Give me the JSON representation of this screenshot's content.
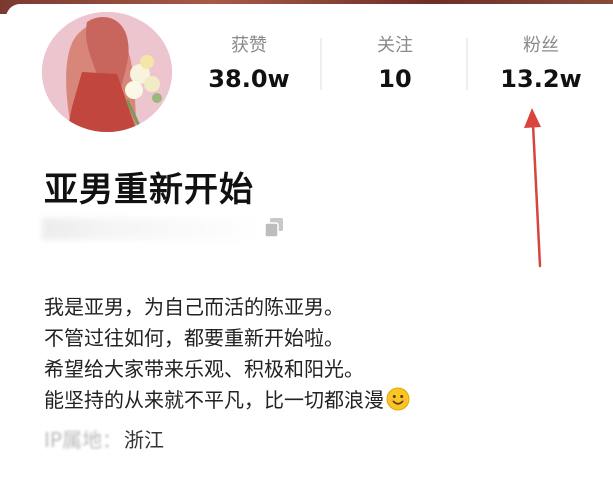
{
  "profile": {
    "name": "亚男重新开始",
    "id_text": "",
    "stats": [
      {
        "label": "获赞",
        "value": "38.0w"
      },
      {
        "label": "关注",
        "value": "10"
      },
      {
        "label": "粉丝",
        "value": "13.2w"
      }
    ],
    "bio": [
      "我是亚男，为自己而活的陈亚男。",
      "不管过往如何，都要重新开始啦。",
      "希望给大家带来乐观、积极和阳光。",
      "能坚持的从来就不平凡，比一切都浪漫"
    ],
    "emoji_icon": "smiling-face-icon",
    "ip_label": "IP属地：",
    "ip_value": "浙江"
  },
  "colors": {
    "annotation_arrow": "#d9443c",
    "label_gray": "#8a8a8a"
  }
}
